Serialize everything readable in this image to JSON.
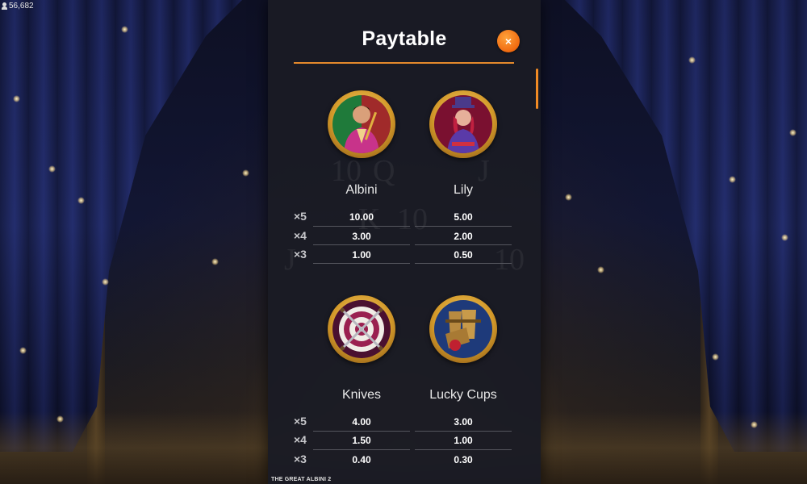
{
  "counter": {
    "value": "56,682",
    "icon": "person-icon"
  },
  "modal": {
    "title": "Paytable",
    "close_label": "×",
    "accent_color": "#e4892c"
  },
  "symbols": [
    {
      "name": "Albini",
      "icon": "albini-symbol-icon",
      "pays": [
        {
          "mult": "×5",
          "value": "10.00"
        },
        {
          "mult": "×4",
          "value": "3.00"
        },
        {
          "mult": "×3",
          "value": "1.00"
        }
      ]
    },
    {
      "name": "Lily",
      "icon": "lily-symbol-icon",
      "pays": [
        {
          "mult": "×5",
          "value": "5.00"
        },
        {
          "mult": "×4",
          "value": "2.00"
        },
        {
          "mult": "×3",
          "value": "0.50"
        }
      ]
    },
    {
      "name": "Knives",
      "icon": "knives-symbol-icon",
      "pays": [
        {
          "mult": "×5",
          "value": "4.00"
        },
        {
          "mult": "×4",
          "value": "1.50"
        },
        {
          "mult": "×3",
          "value": "0.40"
        }
      ]
    },
    {
      "name": "Lucky Cups",
      "icon": "lucky-cups-symbol-icon",
      "pays": [
        {
          "mult": "×5",
          "value": "3.00"
        },
        {
          "mult": "×4",
          "value": "1.00"
        },
        {
          "mult": "×3",
          "value": "0.30"
        }
      ]
    }
  ],
  "footer": {
    "game_title": "THE GREAT ALBINI 2"
  }
}
